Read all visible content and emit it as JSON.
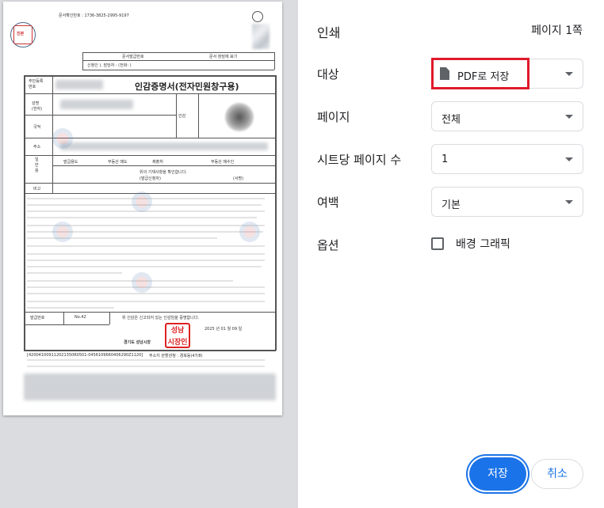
{
  "preview": {
    "doc_number": "문서확인번호 : 1736-3825-2995-9197",
    "doc_issue_no": "문서발급번호",
    "doc_reply": "문서 창담에 표기",
    "applicant_row": "신청인             ), 담당자 :          (전화:          )",
    "seal_label": "진본",
    "title": "인감증명서(전자민원창구용)",
    "fields": {
      "resident_no": "주민등록\n번호",
      "name": "성명\n(한자)",
      "nationality": "국적",
      "seal": "인감",
      "address": "주소",
      "general_use": "일\n반\n용",
      "note": "비고"
    },
    "table_headers": [
      "발급용도",
      "부동산 매도",
      "제출처",
      "부동산 매수인"
    ],
    "confirm_text": "위의 기재사항을 확인합니다.",
    "applicant_sign": "(발급신청자)",
    "sign_label": "(서명)",
    "issue_no_label": "발급번호",
    "issue_no_value": "No.42",
    "certify_text": "위 인감은 신고되어 있는 인감임을 증명합니다.",
    "date": "2025 년 01 월 09 일",
    "issuer": "경기도 성남시장",
    "stamp_text": "성남\n시장인",
    "footer_code": "[420041009112021350R0501-0456109660406290Z1120]",
    "footer_mid": "주소지 관할관청 : 경북동(47/8)"
  },
  "header": {
    "title": "인쇄",
    "page_count": "페이지 1쪽"
  },
  "settings": {
    "destination": {
      "label": "대상",
      "value": "PDF로 저장",
      "icon": "file-icon"
    },
    "pages": {
      "label": "페이지",
      "value": "전체"
    },
    "pages_per_sheet": {
      "label": "시트당 페이지 수",
      "value": "1"
    },
    "margins": {
      "label": "여백",
      "value": "기본"
    },
    "options": {
      "label": "옵션",
      "checkbox_label": "배경 그래픽",
      "checked": false
    }
  },
  "buttons": {
    "save": "저장",
    "cancel": "취소"
  },
  "colors": {
    "accent": "#1a73e8",
    "highlight": "#e0192b",
    "preview_bg": "#dadce0"
  }
}
